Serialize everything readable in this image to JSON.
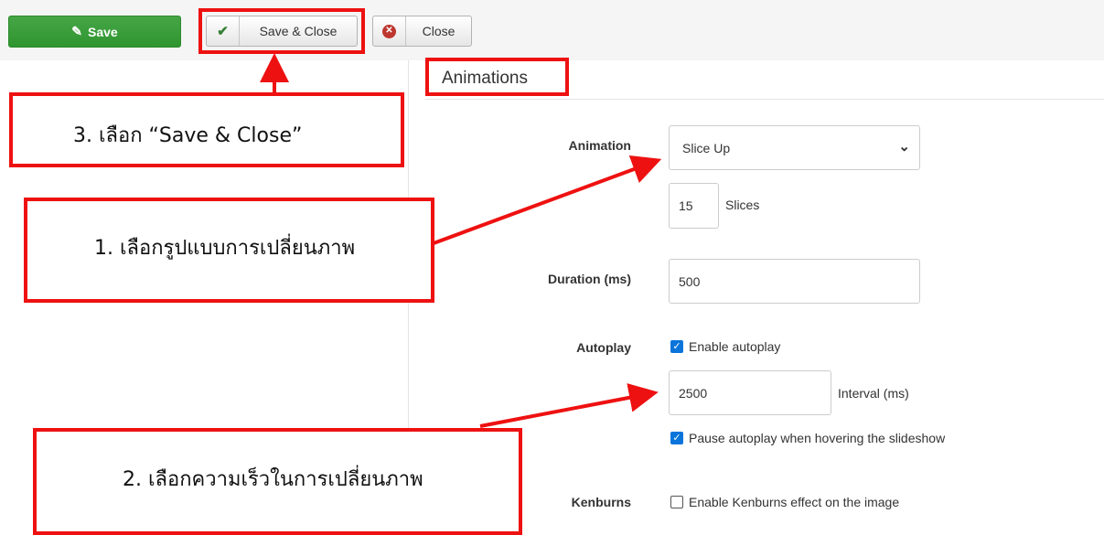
{
  "toolbar": {
    "save_label": "Save",
    "save_close_label": "Save & Close",
    "close_label": "Close"
  },
  "section": {
    "legend": "Animations"
  },
  "fields": {
    "animation_label": "Animation",
    "animation_value": "Slice Up",
    "slices_value": "15",
    "slices_label": "Slices",
    "duration_label": "Duration (ms)",
    "duration_value": "500",
    "autoplay_label": "Autoplay",
    "autoplay_checkbox_label": "Enable autoplay",
    "autoplay_checked": true,
    "interval_value": "2500",
    "interval_label": "Interval (ms)",
    "pause_checkbox_label": "Pause autoplay when hovering the slideshow",
    "pause_checked": true,
    "kenburns_label": "Kenburns",
    "kenburns_checkbox_label": "Enable Kenburns effect on the image",
    "kenburns_checked": false
  },
  "annotations": {
    "step1": "1. เลือกรูปแบบการเปลี่ยนภาพ",
    "step2": "2. เลือกความเร็วในการเปลี่ยนภาพ",
    "step3": "3. เลือก “Save & Close”"
  },
  "colors": {
    "annotation_red": "#ee1111",
    "save_green": "#3a9d3a",
    "checkbox_blue": "#0a74da"
  },
  "icons": {
    "save": "edit-square-icon",
    "save_close": "check-icon",
    "close": "x-circle-icon",
    "select": "chevron-down-icon"
  }
}
